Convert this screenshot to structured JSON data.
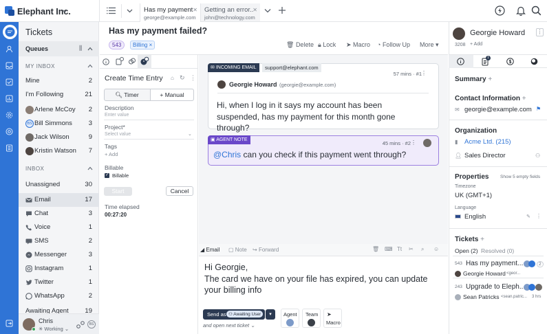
{
  "brand": {
    "name": "Elephant Inc."
  },
  "tabs": [
    {
      "title": "Has my payment...",
      "subtitle": "george@example.com"
    },
    {
      "title": "Getting an error...",
      "subtitle": "john@technology.com"
    }
  ],
  "sidebar": {
    "title": "Tickets",
    "queues_label": "Queues",
    "my_inbox_label": "MY INBOX",
    "inbox_label": "INBOX",
    "my_inbox": [
      {
        "label": "Mine",
        "count": "2"
      },
      {
        "label": "I'm Following",
        "count": "21"
      },
      {
        "label": "Arlene McCoy",
        "count": "2"
      },
      {
        "label": "Bill Simmons",
        "count": "3"
      },
      {
        "label": "Jack Wilson",
        "count": "9"
      },
      {
        "label": "Kristin Watson",
        "count": "7"
      }
    ],
    "inbox": [
      {
        "label": "Unassigned",
        "count": "30"
      },
      {
        "label": "Email",
        "count": "17"
      },
      {
        "label": "Chat",
        "count": "3"
      },
      {
        "label": "Voice",
        "count": "1"
      },
      {
        "label": "SMS",
        "count": "2"
      },
      {
        "label": "Messenger",
        "count": "3"
      },
      {
        "label": "Instagram",
        "count": "1"
      },
      {
        "label": "Twitter",
        "count": "1"
      },
      {
        "label": "WhatsApp",
        "count": "2"
      },
      {
        "label": "Awaiting Agent",
        "count": "19"
      }
    ],
    "user": {
      "name": "Chris",
      "status": "Working",
      "initials": "BS"
    }
  },
  "ticket": {
    "title": "Has my payment failed?",
    "id": "543",
    "tag": "Billing",
    "actions": {
      "delete": "Delete",
      "lock": "Lock",
      "macro": "Macro",
      "follow_up": "Follow Up",
      "more": "More"
    }
  },
  "time_entry": {
    "title": "Create Time Entry",
    "timer_label": "Timer",
    "manual_label": "Manual",
    "description_label": "Description",
    "description_placeholder": "Enter value",
    "project_label": "Project*",
    "project_placeholder": "Select value",
    "tags_label": "Tags",
    "add_label": "+ Add",
    "billable_label": "Billable",
    "billable_checkbox": "Billable",
    "start_label": "Start",
    "cancel_label": "Cancel",
    "elapsed_label": "Time elapsed",
    "elapsed_value": "00:27:20"
  },
  "messages": [
    {
      "chip": "INCOMING EMAIL",
      "channel": "support@elephant.com",
      "time": "57 mins",
      "num": "#1",
      "author": "Georgie Howard",
      "email": "(georgie@example.com)",
      "text": "Hi, when I log in it says my account has been suspended, has my payment for this month gone through?"
    },
    {
      "chip": "AGENT NOTE",
      "time": "45 mins",
      "num": "#2",
      "mention": "@Chris",
      "text": " can you check if this payment went through?"
    }
  ],
  "composer": {
    "tabs": [
      "Email",
      "Note",
      "Forward"
    ],
    "body_lines": [
      "Hi Georgie,",
      "The card we have on your file has expired, you can update your billing info"
    ],
    "send_as": "Send as",
    "status": "Awaiting User",
    "open_next": "and open next ticket",
    "agent_label": "Agent",
    "team_label": "Team",
    "macro_label": "Macro"
  },
  "contact": {
    "name": "Georgie Howard",
    "id": "3208",
    "add": "+ Add",
    "summary": "Summary",
    "contact_info": "Contact Information",
    "email": "georgie@example.com",
    "organization_label": "Organization",
    "organization": "Acme Ltd. (215)",
    "role": "Sales Director",
    "properties_label": "Properties",
    "show_empty": "Show 5 empty fields",
    "timezone_label": "Timezone",
    "timezone": "UK (GMT+1)",
    "language_label": "Language",
    "language": "English",
    "tickets_label": "Tickets",
    "open_tab": "Open (2)",
    "resolved_tab": "Resolved (0)",
    "tickets": [
      {
        "id": "543",
        "title": "Has my payment...",
        "count": "2",
        "person": "Georgie Howard",
        "email": "<geor..."
      },
      {
        "id": "243",
        "title": "Upgrade to Eleph...",
        "count": "",
        "person": "Sean Patricks",
        "email": "<sean.patric...",
        "age": "3 hrs"
      }
    ]
  },
  "colors": {
    "accent": "#2f74d6",
    "note": "#6a48c9",
    "dark": "#2b3a52"
  }
}
